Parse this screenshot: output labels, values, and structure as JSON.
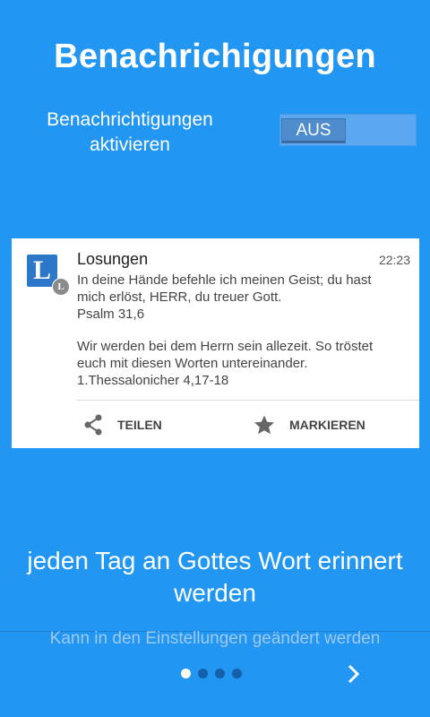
{
  "header": {
    "title": "Benachrichigungen"
  },
  "toggle": {
    "label": "Benachrichtigungen aktivieren",
    "state_label": "AUS",
    "enabled": false
  },
  "notification": {
    "app_icon_letter": "L",
    "app_name": "Losungen",
    "time": "22:23",
    "verse1_text": "In deine Hände befehle ich meinen Geist; du hast mich erlöst, HERR, du treuer Gott.",
    "verse1_ref": "Psalm 31,6",
    "verse2_text": "Wir werden bei dem Herrn sein allezeit. So tröstet euch mit diesen Worten untereinander.",
    "verse2_ref": "1.Thessalonicher 4,17-18",
    "actions": [
      {
        "label": "TEILEN",
        "icon": "share-icon"
      },
      {
        "label": "MARKIEREN",
        "icon": "star-icon"
      }
    ]
  },
  "subtitle": "jeden Tag an Gottes Wort erinnert werden",
  "hint": "Kann in den Einstellungen geändert werden",
  "pager": {
    "total": 4,
    "current": 1
  },
  "colors": {
    "background": "#2196F3",
    "card": "#FFFFFF",
    "toggle_off": "#4E8CCD"
  }
}
